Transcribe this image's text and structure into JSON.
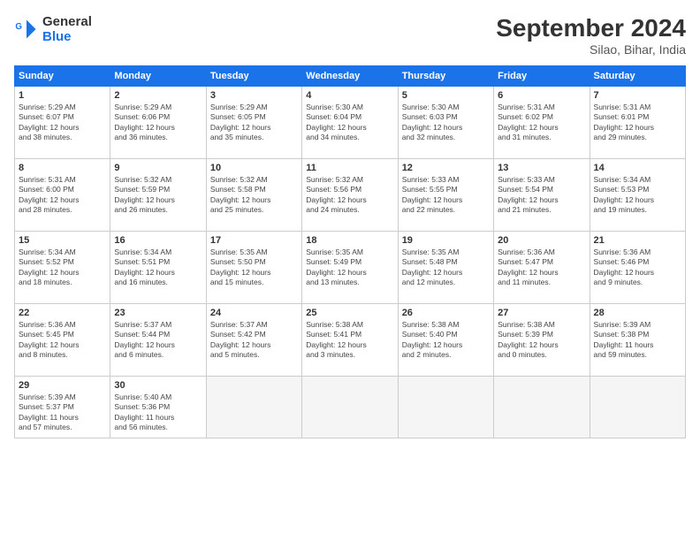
{
  "logo": {
    "line1": "General",
    "line2": "Blue"
  },
  "title": "September 2024",
  "subtitle": "Silao, Bihar, India",
  "days_header": [
    "Sunday",
    "Monday",
    "Tuesday",
    "Wednesday",
    "Thursday",
    "Friday",
    "Saturday"
  ],
  "weeks": [
    [
      {
        "day": "1",
        "info": "Sunrise: 5:29 AM\nSunset: 6:07 PM\nDaylight: 12 hours\nand 38 minutes."
      },
      {
        "day": "2",
        "info": "Sunrise: 5:29 AM\nSunset: 6:06 PM\nDaylight: 12 hours\nand 36 minutes."
      },
      {
        "day": "3",
        "info": "Sunrise: 5:29 AM\nSunset: 6:05 PM\nDaylight: 12 hours\nand 35 minutes."
      },
      {
        "day": "4",
        "info": "Sunrise: 5:30 AM\nSunset: 6:04 PM\nDaylight: 12 hours\nand 34 minutes."
      },
      {
        "day": "5",
        "info": "Sunrise: 5:30 AM\nSunset: 6:03 PM\nDaylight: 12 hours\nand 32 minutes."
      },
      {
        "day": "6",
        "info": "Sunrise: 5:31 AM\nSunset: 6:02 PM\nDaylight: 12 hours\nand 31 minutes."
      },
      {
        "day": "7",
        "info": "Sunrise: 5:31 AM\nSunset: 6:01 PM\nDaylight: 12 hours\nand 29 minutes."
      }
    ],
    [
      {
        "day": "8",
        "info": "Sunrise: 5:31 AM\nSunset: 6:00 PM\nDaylight: 12 hours\nand 28 minutes."
      },
      {
        "day": "9",
        "info": "Sunrise: 5:32 AM\nSunset: 5:59 PM\nDaylight: 12 hours\nand 26 minutes."
      },
      {
        "day": "10",
        "info": "Sunrise: 5:32 AM\nSunset: 5:58 PM\nDaylight: 12 hours\nand 25 minutes."
      },
      {
        "day": "11",
        "info": "Sunrise: 5:32 AM\nSunset: 5:56 PM\nDaylight: 12 hours\nand 24 minutes."
      },
      {
        "day": "12",
        "info": "Sunrise: 5:33 AM\nSunset: 5:55 PM\nDaylight: 12 hours\nand 22 minutes."
      },
      {
        "day": "13",
        "info": "Sunrise: 5:33 AM\nSunset: 5:54 PM\nDaylight: 12 hours\nand 21 minutes."
      },
      {
        "day": "14",
        "info": "Sunrise: 5:34 AM\nSunset: 5:53 PM\nDaylight: 12 hours\nand 19 minutes."
      }
    ],
    [
      {
        "day": "15",
        "info": "Sunrise: 5:34 AM\nSunset: 5:52 PM\nDaylight: 12 hours\nand 18 minutes."
      },
      {
        "day": "16",
        "info": "Sunrise: 5:34 AM\nSunset: 5:51 PM\nDaylight: 12 hours\nand 16 minutes."
      },
      {
        "day": "17",
        "info": "Sunrise: 5:35 AM\nSunset: 5:50 PM\nDaylight: 12 hours\nand 15 minutes."
      },
      {
        "day": "18",
        "info": "Sunrise: 5:35 AM\nSunset: 5:49 PM\nDaylight: 12 hours\nand 13 minutes."
      },
      {
        "day": "19",
        "info": "Sunrise: 5:35 AM\nSunset: 5:48 PM\nDaylight: 12 hours\nand 12 minutes."
      },
      {
        "day": "20",
        "info": "Sunrise: 5:36 AM\nSunset: 5:47 PM\nDaylight: 12 hours\nand 11 minutes."
      },
      {
        "day": "21",
        "info": "Sunrise: 5:36 AM\nSunset: 5:46 PM\nDaylight: 12 hours\nand 9 minutes."
      }
    ],
    [
      {
        "day": "22",
        "info": "Sunrise: 5:36 AM\nSunset: 5:45 PM\nDaylight: 12 hours\nand 8 minutes."
      },
      {
        "day": "23",
        "info": "Sunrise: 5:37 AM\nSunset: 5:44 PM\nDaylight: 12 hours\nand 6 minutes."
      },
      {
        "day": "24",
        "info": "Sunrise: 5:37 AM\nSunset: 5:42 PM\nDaylight: 12 hours\nand 5 minutes."
      },
      {
        "day": "25",
        "info": "Sunrise: 5:38 AM\nSunset: 5:41 PM\nDaylight: 12 hours\nand 3 minutes."
      },
      {
        "day": "26",
        "info": "Sunrise: 5:38 AM\nSunset: 5:40 PM\nDaylight: 12 hours\nand 2 minutes."
      },
      {
        "day": "27",
        "info": "Sunrise: 5:38 AM\nSunset: 5:39 PM\nDaylight: 12 hours\nand 0 minutes."
      },
      {
        "day": "28",
        "info": "Sunrise: 5:39 AM\nSunset: 5:38 PM\nDaylight: 11 hours\nand 59 minutes."
      }
    ],
    [
      {
        "day": "29",
        "info": "Sunrise: 5:39 AM\nSunset: 5:37 PM\nDaylight: 11 hours\nand 57 minutes."
      },
      {
        "day": "30",
        "info": "Sunrise: 5:40 AM\nSunset: 5:36 PM\nDaylight: 11 hours\nand 56 minutes."
      },
      {
        "day": "",
        "info": ""
      },
      {
        "day": "",
        "info": ""
      },
      {
        "day": "",
        "info": ""
      },
      {
        "day": "",
        "info": ""
      },
      {
        "day": "",
        "info": ""
      }
    ]
  ]
}
